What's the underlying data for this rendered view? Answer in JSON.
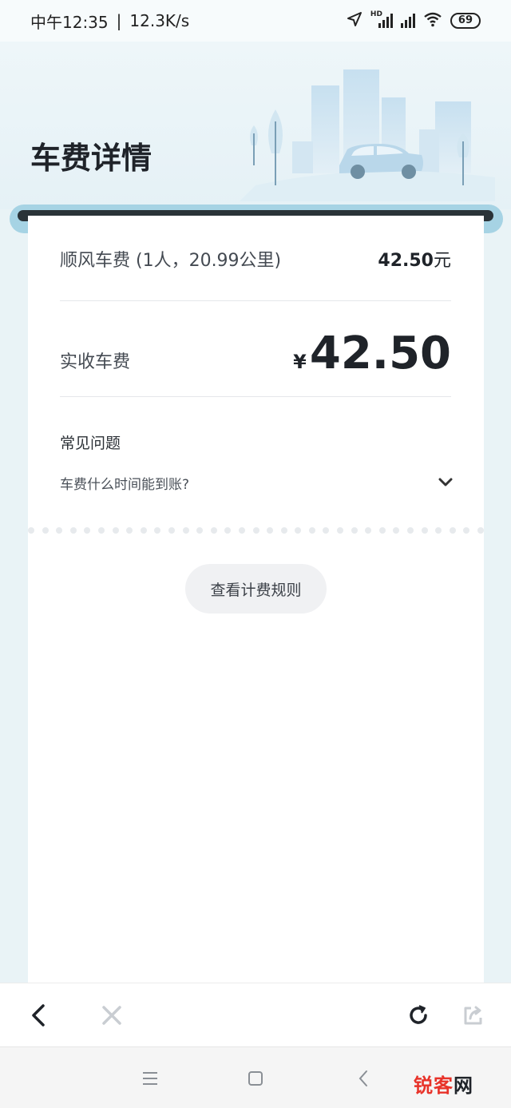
{
  "status_bar": {
    "time": "中午12:35",
    "separator": "|",
    "speed": "12.3K/s",
    "battery": "69",
    "hd_label": "HD",
    "icons": [
      "location-icon",
      "signal-hd-icon",
      "signal-icon",
      "wifi-icon",
      "battery-icon"
    ]
  },
  "header": {
    "title": "车费详情"
  },
  "fare": {
    "label": "顺风车费 (1人，20.99公里)",
    "amount": "42.50",
    "unit": "元"
  },
  "actual": {
    "label": "实收车费",
    "currency": "¥",
    "amount": "42.50"
  },
  "faq": {
    "title": "常见问题",
    "items": [
      {
        "question": "车费什么时间能到账?"
      }
    ]
  },
  "rules_button": {
    "label": "查看计费规则"
  },
  "toolbar": {
    "icons": [
      "back-icon",
      "close-icon",
      "refresh-icon",
      "share-icon"
    ]
  },
  "navbar": {
    "icons": [
      "menu-icon",
      "home-icon",
      "nav-back-icon"
    ]
  },
  "watermark": {
    "part1": "锐客",
    "part2": "网"
  },
  "colors": {
    "background": "#e9f3f6",
    "roller": "#a6d3e4",
    "card": "#ffffff",
    "text_primary": "#1f2329",
    "watermark_red": "#e8332a"
  }
}
